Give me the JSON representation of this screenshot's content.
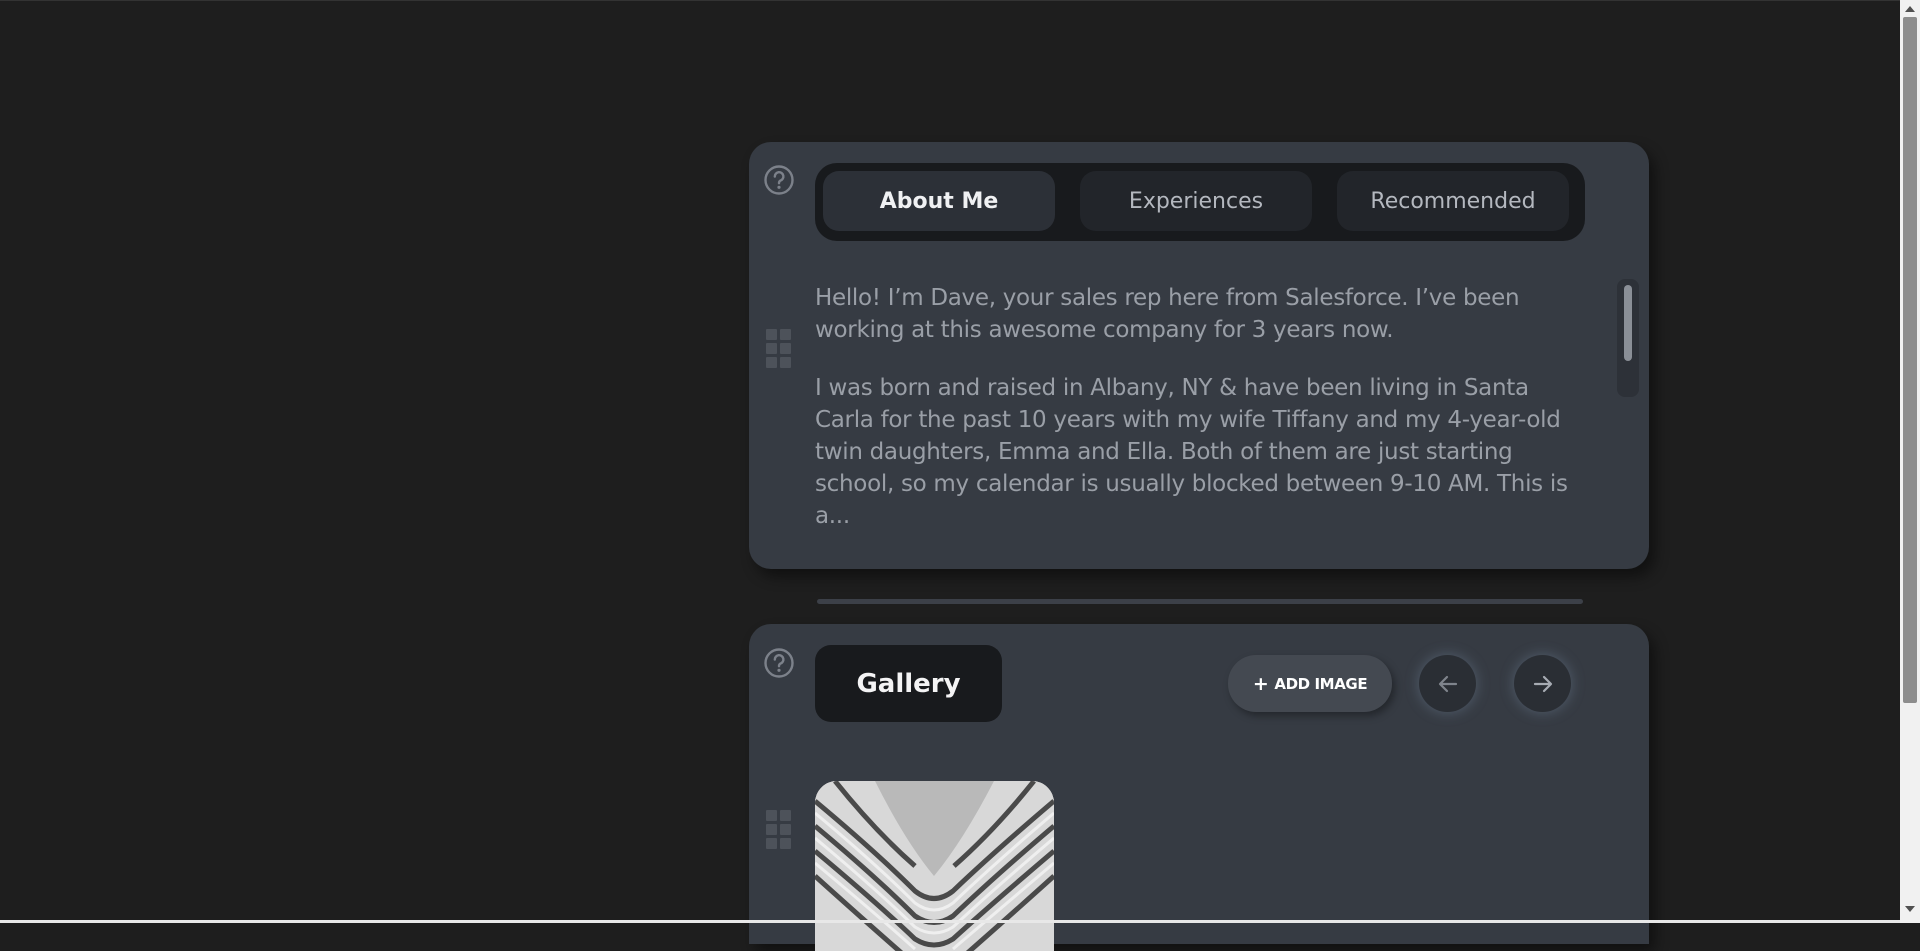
{
  "about": {
    "tabs": [
      {
        "label": "About Me",
        "active": true
      },
      {
        "label": "Experiences",
        "active": false
      },
      {
        "label": "Recommended",
        "active": false
      }
    ],
    "paragraphs": [
      "Hello! I’m Dave, your sales rep here from Salesforce. I’ve been working at this awesome company for 3 years now.",
      "I was born and raised in Albany, NY & have been living in Santa Carla for the past 10 years with my wife Tiffany and my 4-year-old twin daughters, Emma and Ella. Both of them are just starting school, so my calendar is usually blocked between 9-10 AM. This is a..."
    ]
  },
  "gallery": {
    "title": "Gallery",
    "add_image_label": "ADD IMAGE",
    "add_image_icon": "plus-icon",
    "prev_icon": "arrow-left-icon",
    "next_icon": "arrow-right-icon"
  },
  "icons": {
    "help": "question-circle-icon",
    "drag": "grip-icon"
  },
  "colors": {
    "page_bg": "#1e1e1e",
    "card_bg": "#363b43",
    "tab_strip_bg": "#181a1d",
    "text_muted": "#9a9fa7"
  }
}
